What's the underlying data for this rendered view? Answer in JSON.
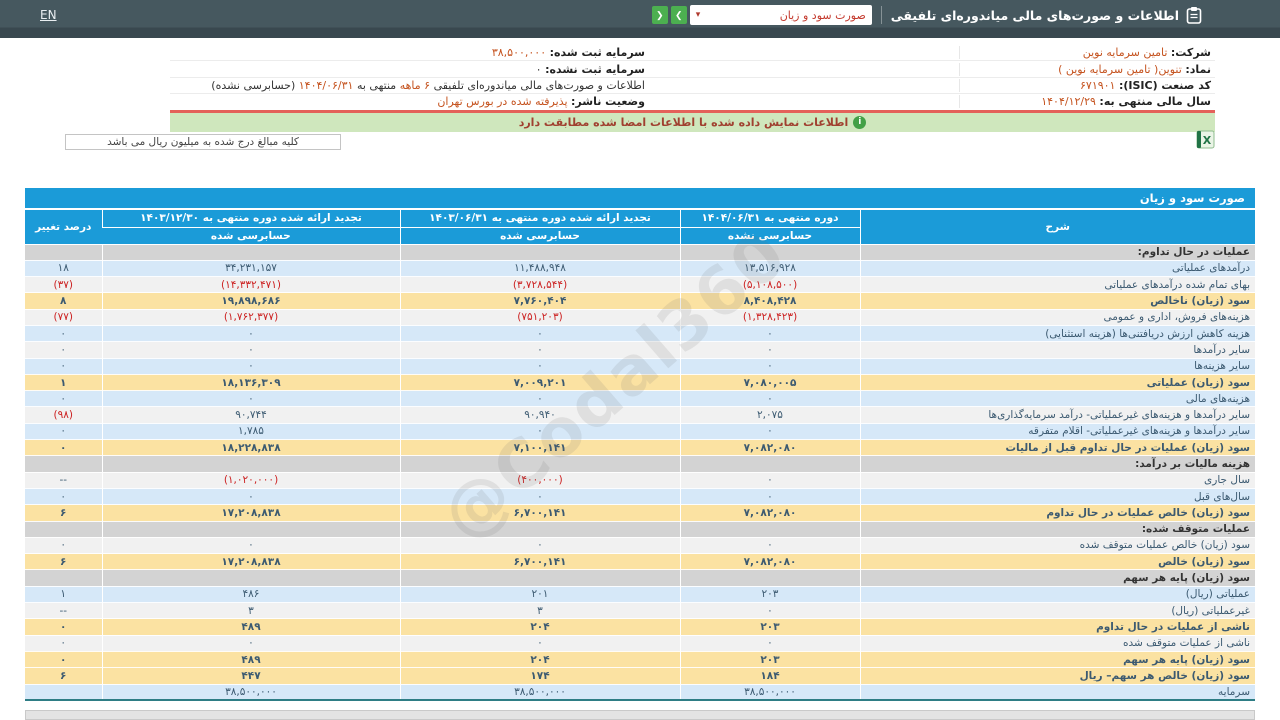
{
  "topbar": {
    "lang": "EN",
    "title": "اطلاعات و صورت‌های مالی میاندوره‌ای تلفیقی",
    "report_select_value": "صورت سود و زیان"
  },
  "icons": {
    "dropdown_caret": "▾",
    "nav_right": "❯",
    "nav_left": "❮",
    "info": "i"
  },
  "info_panel": {
    "right_rows": [
      {
        "label": "شرکت:",
        "value": "تامین سرمایه نوین"
      },
      {
        "label": "نماد:",
        "value": "تنوین( تامین سرمایه نوین )"
      },
      {
        "label": "کد صنعت (ISIC):",
        "value": "۶۷۱۹۰۱"
      },
      {
        "label": "سال مالی منتهی به:",
        "value": "۱۴۰۴/۱۲/۲۹"
      }
    ],
    "left_rows": [
      {
        "label": "سرمایه ثبت شده:",
        "value": "۳۸,۵۰۰,۰۰۰"
      },
      {
        "label": "سرمایه ثبت نشده:",
        "value": "۰"
      },
      {
        "label": "وضعیت ناشر:",
        "value": "پذیرفته شده در بورس تهران"
      }
    ],
    "period_line": {
      "p1": "اطلاعات و صورت‌های مالی میاندوره‌ای تلفیقی",
      "p2": "۶ ماهه",
      "p3": "منتهی به",
      "p4": "۱۴۰۴/۰۶/۳۱",
      "p5": "(حسابرسی نشده)"
    }
  },
  "banner": {
    "text": "اطلاعات نمایش داده شده با اطلاعات امضا شده مطابقت دارد"
  },
  "units_note": "کلیه مبالغ درج شده به میلیون ریال می باشد",
  "watermark": "@Codal360",
  "table": {
    "title": "صورت سود و زیان",
    "columns": {
      "desc": "شرح",
      "col_current_l1": "دوره منتهی به ۱۴۰۴/۰۶/۳۱",
      "col_current_l2": "حسابرسی نشده",
      "col_mid_l1": "تجدید ارائه شده دوره منتهی به ۱۴۰۳/۰۶/۳۱",
      "col_mid_l2": "حسابرسی شده",
      "col_year_l1": "تجدید ارائه شده دوره منتهی به ۱۴۰۳/۱۲/۳۰",
      "col_year_l2": "حسابرسی شده",
      "pct": "درصد تغییر"
    },
    "rows": [
      {
        "type": "section",
        "label": "عملیات در حال تداوم:"
      },
      {
        "type": "data",
        "style": "blue",
        "label": "درآمدهای عملیاتی",
        "v": [
          "۱۳,۵۱۶,۹۲۸",
          "۱۱,۴۸۸,۹۴۸",
          "۳۴,۲۳۱,۱۵۷",
          "۱۸"
        ]
      },
      {
        "type": "data",
        "style": "white",
        "label": "بهای تمام شده درآمدهای عملیاتی",
        "v": [
          "(۵,۱۰۸,۵۰۰)",
          "(۳,۷۲۸,۵۴۴)",
          "(۱۴,۳۳۲,۴۷۱)",
          "(۳۷)"
        ]
      },
      {
        "type": "data",
        "style": "yellow",
        "label": "سود (زیان) ناخالص",
        "v": [
          "۸,۴۰۸,۴۲۸",
          "۷,۷۶۰,۴۰۴",
          "۱۹,۸۹۸,۶۸۶",
          "۸"
        ]
      },
      {
        "type": "data",
        "style": "white",
        "label": "هزینه‌های فروش، اداری و عمومی",
        "v": [
          "(۱,۳۲۸,۴۲۳)",
          "(۷۵۱,۲۰۳)",
          "(۱,۷۶۲,۳۷۷)",
          "(۷۷)"
        ]
      },
      {
        "type": "data",
        "style": "blue",
        "label": "هزینه کاهش ارزش دریافتنی‌ها (هزینه استثنایی)",
        "v": [
          "۰",
          "۰",
          "۰",
          "۰"
        ]
      },
      {
        "type": "data",
        "style": "white",
        "label": "سایر درآمدها",
        "v": [
          "۰",
          "۰",
          "۰",
          "۰"
        ]
      },
      {
        "type": "data",
        "style": "blue",
        "label": "سایر هزینه‌ها",
        "v": [
          "۰",
          "۰",
          "۰",
          "۰"
        ]
      },
      {
        "type": "data",
        "style": "yellow",
        "label": "سود (زیان) عملیاتی",
        "v": [
          "۷,۰۸۰,۰۰۵",
          "۷,۰۰۹,۲۰۱",
          "۱۸,۱۳۶,۳۰۹",
          "۱"
        ]
      },
      {
        "type": "data",
        "style": "blue",
        "label": "هزینه‌های مالی",
        "v": [
          "۰",
          "۰",
          "۰",
          "۰"
        ]
      },
      {
        "type": "data",
        "style": "white",
        "label": "سایر درآمدها و هزینه‌های غیرعملیاتی- درآمد سرمایه‌گذاری‌ها",
        "v": [
          "۲,۰۷۵",
          "۹۰,۹۴۰",
          "۹۰,۷۴۴",
          "(۹۸)"
        ]
      },
      {
        "type": "data",
        "style": "blue",
        "label": "سایر درآمدها و هزینه‌های غیرعملیاتی- اقلام متفرقه",
        "v": [
          "۰",
          "۰",
          "۱,۷۸۵",
          "۰"
        ]
      },
      {
        "type": "data",
        "style": "yellow",
        "label": "سود (زیان) عملیات در حال تداوم قبل از مالیات",
        "v": [
          "۷,۰۸۲,۰۸۰",
          "۷,۱۰۰,۱۴۱",
          "۱۸,۲۲۸,۸۳۸",
          "۰"
        ]
      },
      {
        "type": "section",
        "label": "هزینه مالیات بر درآمد:"
      },
      {
        "type": "data",
        "style": "white",
        "label": "سال جاری",
        "v": [
          "۰",
          "(۴۰۰,۰۰۰)",
          "(۱,۰۲۰,۰۰۰)",
          "--"
        ]
      },
      {
        "type": "data",
        "style": "blue",
        "label": "سال‌های قبل",
        "v": [
          "۰",
          "۰",
          "۰",
          "۰"
        ]
      },
      {
        "type": "data",
        "style": "yellow",
        "label": "سود (زیان) خالص عملیات در حال تداوم",
        "v": [
          "۷,۰۸۲,۰۸۰",
          "۶,۷۰۰,۱۴۱",
          "۱۷,۲۰۸,۸۳۸",
          "۶"
        ]
      },
      {
        "type": "section",
        "label": "عملیات متوقف شده:"
      },
      {
        "type": "data",
        "style": "white",
        "label": "سود (زیان) خالص عملیات متوقف شده",
        "v": [
          "۰",
          "۰",
          "۰",
          "۰"
        ]
      },
      {
        "type": "data",
        "style": "yellow",
        "label": "سود (زیان) خالص",
        "v": [
          "۷,۰۸۲,۰۸۰",
          "۶,۷۰۰,۱۴۱",
          "۱۷,۲۰۸,۸۳۸",
          "۶"
        ]
      },
      {
        "type": "section",
        "label": "سود (زیان) پایه هر سهم"
      },
      {
        "type": "data",
        "style": "blue",
        "label": "عملیاتی (ریال)",
        "v": [
          "۲۰۳",
          "۲۰۱",
          "۴۸۶",
          "۱"
        ]
      },
      {
        "type": "data",
        "style": "white",
        "label": "غیرعملیاتی (ریال)",
        "v": [
          "۰",
          "۳",
          "۳",
          "--"
        ]
      },
      {
        "type": "data",
        "style": "yellow",
        "label": "ناشی از عملیات در حال تداوم",
        "v": [
          "۲۰۳",
          "۲۰۴",
          "۴۸۹",
          "۰"
        ]
      },
      {
        "type": "data",
        "style": "white",
        "label": "ناشی از عملیات متوقف شده",
        "v": [
          "۰",
          "۰",
          "۰",
          "۰"
        ]
      },
      {
        "type": "data",
        "style": "yellow",
        "label": "سود (زیان) پایه هر سهم",
        "v": [
          "۲۰۳",
          "۲۰۴",
          "۴۸۹",
          "۰"
        ]
      },
      {
        "type": "data",
        "style": "yellow",
        "label": "سود (زیان) خالص هر سهم– ریال",
        "v": [
          "۱۸۴",
          "۱۷۴",
          "۴۴۷",
          "۶"
        ]
      },
      {
        "type": "data",
        "style": "blue",
        "label": "سرمایه",
        "v": [
          "۳۸,۵۰۰,۰۰۰",
          "۳۸,۵۰۰,۰۰۰",
          "۳۸,۵۰۰,۰۰۰",
          ""
        ]
      }
    ]
  },
  "colors": {
    "header_bar": "#46585f",
    "accent_blue": "#1b9bd8",
    "row_blue": "#d6e8f8",
    "row_gray": "#f1f1f1",
    "row_highlight": "#fbe2a2",
    "section_gray": "#d3d3d3",
    "negative_red": "#cc2222",
    "value_orange": "#c5531f",
    "banner_green": "#cfe7bd",
    "nav_green": "#4caf50",
    "divider_red": "#e4615a"
  }
}
